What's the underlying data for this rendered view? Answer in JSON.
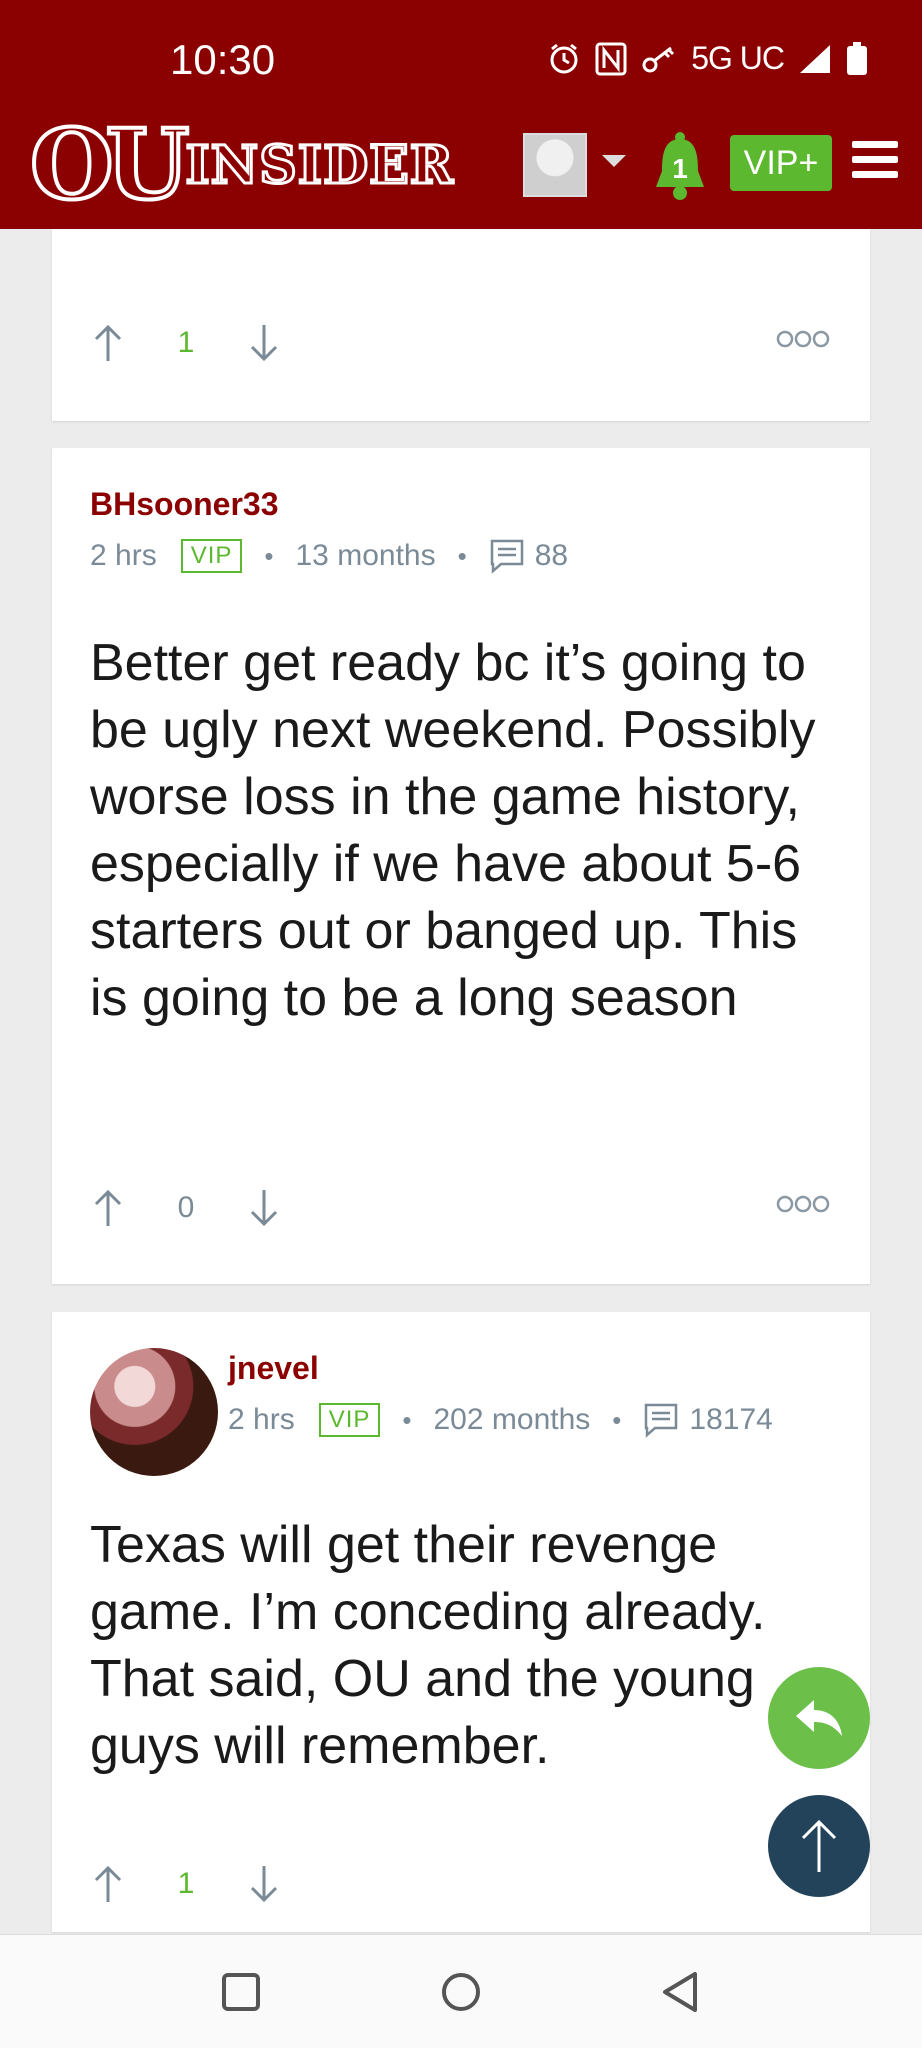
{
  "status_bar": {
    "time": "10:30",
    "network": "5G UC"
  },
  "header": {
    "logo_ou": "OU",
    "logo_insider": "INSIDER",
    "notification_count": "1",
    "vip_label": "VIP+",
    "colors": {
      "brand": "#8b0000",
      "accent_green": "#5cb82e"
    }
  },
  "posts": [
    {
      "votes": "1"
    },
    {
      "author": "BHsooner33",
      "time": "2 hrs",
      "badge": "VIP",
      "tenure": "13 months",
      "post_count": "88",
      "body": "Better get ready bc it’s going to be ugly next weekend. Possibly worse loss in the game history, especially if we have about 5-6 starters out or banged up. This is going to be a long season",
      "votes": "0"
    },
    {
      "author": "jnevel",
      "time": "2 hrs",
      "badge": "VIP",
      "tenure": "202 months",
      "post_count": "18174",
      "body": "Texas will get their revenge game. I’m conceding already. That said, OU and the young guys will remember.",
      "votes": "1"
    }
  ],
  "icons": {
    "upvote": "arrow-up-icon",
    "downvote": "arrow-down-icon",
    "more": "more-dots-icon",
    "reply_fab": "reply-icon",
    "scroll_top_fab": "arrow-up-icon"
  }
}
